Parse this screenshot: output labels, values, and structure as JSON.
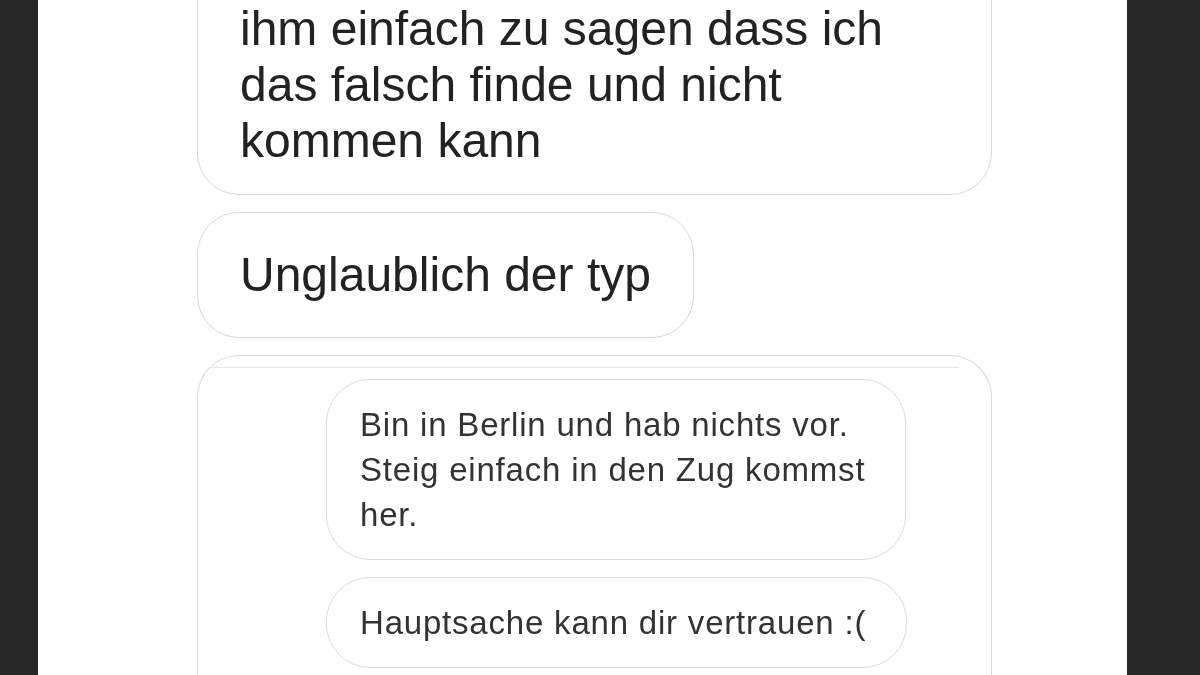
{
  "messages": [
    {
      "kind": "text",
      "lines": [
        "ihm einfach zu sagen dass ich",
        "das falsch finde und nicht",
        "kommen kann"
      ]
    },
    {
      "kind": "text",
      "lines": [
        "Unglaublich der typ"
      ]
    },
    {
      "kind": "screenshot",
      "messages": [
        {
          "lines": [
            "Bin in Berlin und hab nichts vor.",
            "Steig einfach in den Zug kommst",
            "her."
          ]
        },
        {
          "lines": [
            "Hauptsache kann dir vertrauen :("
          ]
        }
      ]
    }
  ]
}
